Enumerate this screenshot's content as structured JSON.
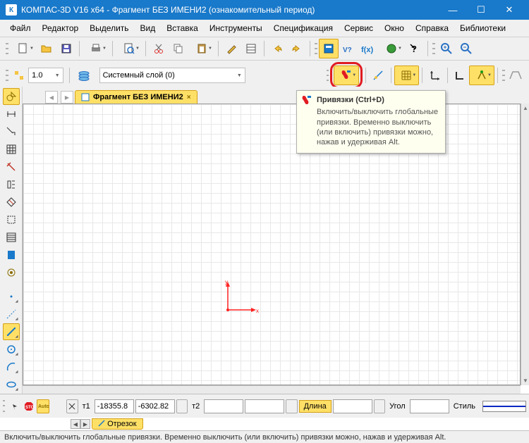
{
  "title": "КОМПАС-3D V16  x64 - Фрагмент БЕЗ ИМЕНИ2 (ознакомительный период)",
  "menubar": [
    "Файл",
    "Редактор",
    "Выделить",
    "Вид",
    "Вставка",
    "Инструменты",
    "Спецификация",
    "Сервис",
    "Окно",
    "Справка",
    "Библиотеки"
  ],
  "lineweight": "1.0",
  "layer": "Системный слой (0)",
  "doc_tab": "Фрагмент БЕЗ ИМЕНИ2",
  "origin": {
    "x_label": "x",
    "y_label": "y"
  },
  "tooltip": {
    "title": "Привязки (Ctrl+D)",
    "body": "Включить/выключить глобальные привязки. Временно выключить (или включить) привязки можно, нажав и удерживая Alt."
  },
  "props": {
    "t1_label": "т1",
    "x1": "-18355.8",
    "y1": "-6302.82",
    "t2_label": "т2",
    "x2": "",
    "y2": "",
    "len_label": "Длина",
    "len": "",
    "ang_label": "Угол",
    "ang": "",
    "style_label": "Стиль"
  },
  "prop_tab": "Отрезок",
  "status": "Включить/выключить глобальные привязки. Временно выключить (или включить) привязки можно, нажав и удерживая Alt."
}
